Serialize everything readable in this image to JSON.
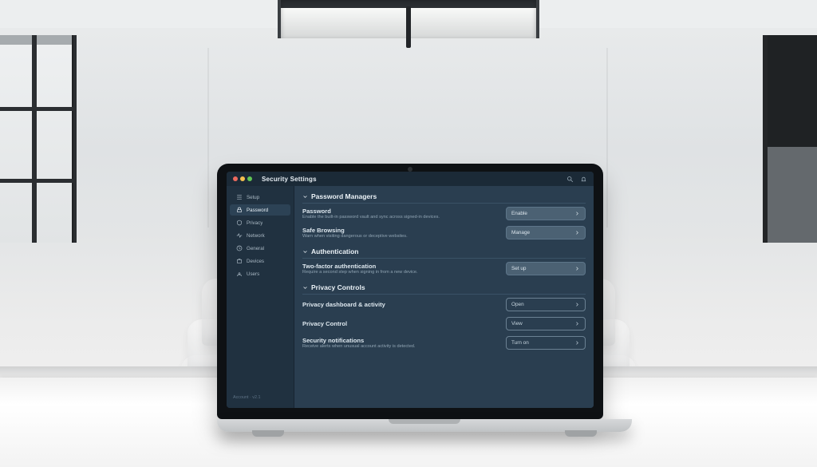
{
  "window": {
    "title": "Security Settings"
  },
  "sidebar": {
    "items": [
      {
        "label": "Setup"
      },
      {
        "label": "Password"
      },
      {
        "label": "Privacy"
      },
      {
        "label": "Network"
      },
      {
        "label": "General"
      },
      {
        "label": "Devices"
      },
      {
        "label": "Users"
      }
    ],
    "footer": "Account · v2.1"
  },
  "sections": [
    {
      "title": "Password Managers",
      "rows": [
        {
          "name": "Password",
          "desc": "Enable the built-in password vault and sync across signed-in devices.",
          "control": {
            "style": "solid",
            "label": "Enable"
          }
        },
        {
          "name": "Safe Browsing",
          "desc": "Warn when visiting dangerous or deceptive websites.",
          "control": {
            "style": "solid",
            "label": "Manage"
          }
        }
      ]
    },
    {
      "title": "Authentication",
      "rows": [
        {
          "name": "Two-factor authentication",
          "desc": "Require a second step when signing in from a new device.",
          "control": {
            "style": "solid",
            "label": "Set up"
          }
        }
      ]
    },
    {
      "title": "Privacy Controls",
      "rows": [
        {
          "name": "Privacy dashboard & activity",
          "desc": "",
          "control": {
            "style": "outline",
            "label": "Open"
          }
        },
        {
          "name": "Privacy Control",
          "desc": "",
          "control": {
            "style": "outline",
            "label": "View"
          }
        },
        {
          "name": "Security notifications",
          "desc": "Receive alerts when unusual account activity is detected.",
          "control": {
            "style": "outline",
            "label": "Turn on"
          }
        }
      ]
    }
  ]
}
